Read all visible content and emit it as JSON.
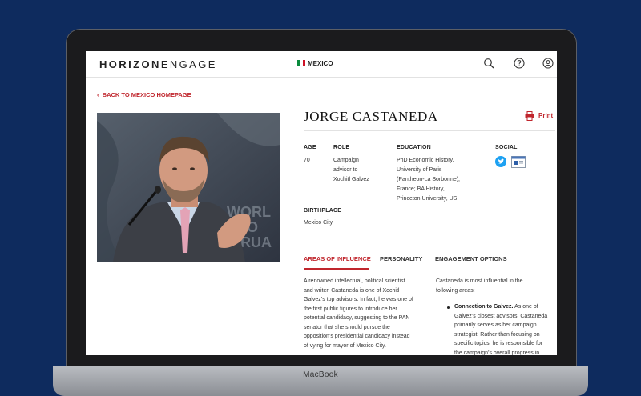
{
  "device": {
    "brand_label": "MacBook"
  },
  "nav": {
    "logo_bold": "HORIZON",
    "logo_thin": "ENGAGE",
    "country": "MEXICO",
    "flag_colors": [
      "#0a8b3d",
      "#ffffff",
      "#ce1126"
    ]
  },
  "page": {
    "back_link": "BACK TO MEXICO HOMEPAGE",
    "person_name": "JORGE CASTANEDA",
    "print_label": "Print",
    "fields": {
      "age_label": "AGE",
      "age_value": "70",
      "role_label": "ROLE",
      "role_lines": [
        "Campaign",
        "advisor to",
        "Xochitl Galvez"
      ],
      "education_label": "EDUCATION",
      "education_lines": [
        "PhD Economic History,",
        "University of Paris",
        "(Pantheon-La Sorbonne),",
        "France; BA History,",
        "Princeton University, US"
      ],
      "social_label": "SOCIAL",
      "birthplace_label": "BIRTHPLACE",
      "birthplace_value": "Mexico City"
    },
    "tabs": [
      "AREAS OF INFLUENCE",
      "PERSONALITY",
      "ENGAGEMENT OPTIONS"
    ],
    "left_paragraph_lines": [
      "A renowned intellectual, political scientist",
      "and writer, Castaneda is one of Xochitl",
      "Galvez’s top advisors. In fact, he was one of",
      "the first public figures to introduce her",
      "potential candidacy, suggesting to the PAN",
      "senator that she should pursue the",
      "opposition’s presidential candidacy instead",
      "of vying for mayor of Mexico City."
    ],
    "right_intro_lines": [
      "Castaneda is most influential in the",
      "following areas:"
    ],
    "bullet_title": "Connection to Galvez.",
    "bullet_lines": [
      "As one of",
      "Galvez’s closest advisors, Castaneda",
      "primarily serves as her campaign",
      "strategist. Rather than focusing on",
      "specific topics, he is responsible for",
      "the campaign’s overall progress in"
    ]
  },
  "colors": {
    "accent": "#c0262d",
    "background": "#0e2b5e"
  },
  "icons": [
    "search-icon",
    "help-icon",
    "user-icon",
    "printer-icon",
    "twitter-icon",
    "website-icon",
    "chevron-left-icon"
  ]
}
